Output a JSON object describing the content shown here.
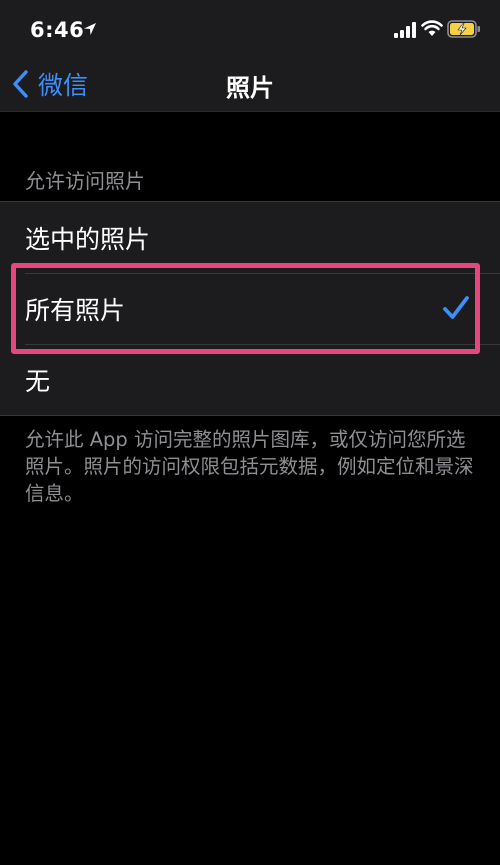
{
  "status_bar": {
    "time": "6:46",
    "icons": [
      "location-arrow-icon",
      "cellular-signal-icon",
      "wifi-icon",
      "battery-charging-icon"
    ]
  },
  "nav": {
    "back_label": "微信",
    "title": "照片"
  },
  "section": {
    "header": "允许访问照片",
    "options": [
      {
        "label": "选中的照片",
        "selected": false
      },
      {
        "label": "所有照片",
        "selected": true
      },
      {
        "label": "无",
        "selected": false
      }
    ],
    "footer": "允许此 App 访问完整的照片图库，或仅访问您所选照片。照片的访问权限包括元数据，例如定位和景深信息。"
  },
  "colors": {
    "accent": "#3d8ef6",
    "highlight": "#e7477c",
    "background": "#000000",
    "group_background": "#1c1c1e",
    "secondary_text": "#8e8e93",
    "battery_charging": "#f7d046"
  }
}
